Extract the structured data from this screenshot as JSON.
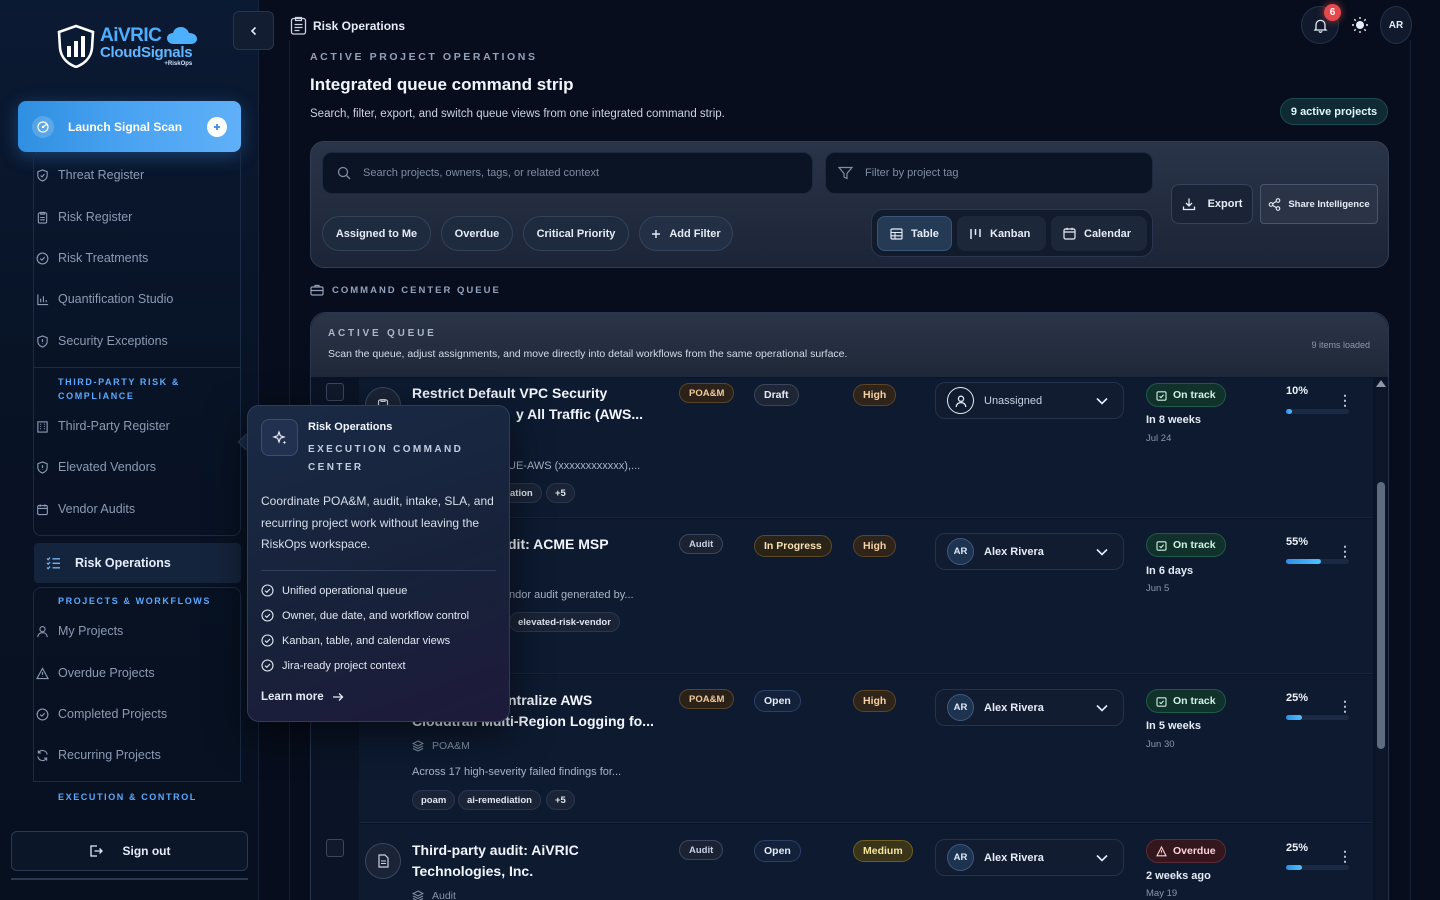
{
  "brand": {
    "name_line1": "AiVRIC",
    "name_line2": "CloudSignals",
    "name_line3": "+RiskOps"
  },
  "sidebar": {
    "launch_label": "Launch Signal Scan",
    "group1": [
      {
        "label": "Threat Register",
        "icon": "shield-icon"
      },
      {
        "label": "Risk Register",
        "icon": "clipboard-icon"
      },
      {
        "label": "Risk Treatments",
        "icon": "check-circle-icon"
      },
      {
        "label": "Quantification Studio",
        "icon": "bar-chart-icon"
      },
      {
        "label": "Security Exceptions",
        "icon": "shield-icon"
      }
    ],
    "section_third_party": "THIRD-PARTY RISK & COMPLIANCE",
    "group2": [
      {
        "label": "Third-Party Register",
        "icon": "building-icon"
      },
      {
        "label": "Elevated Vendors",
        "icon": "shield-icon"
      },
      {
        "label": "Vendor Audits",
        "icon": "calendar-icon"
      }
    ],
    "active_label": "Risk Operations",
    "section_projects": "PROJECTS & WORKFLOWS",
    "group3": [
      {
        "label": "My Projects",
        "icon": "user-icon"
      },
      {
        "label": "Overdue Projects",
        "icon": "warning-icon"
      },
      {
        "label": "Completed Projects",
        "icon": "check-circle-icon"
      },
      {
        "label": "Recurring Projects",
        "icon": "refresh-icon"
      }
    ],
    "section_exec": "EXECUTION & CONTROL",
    "signout_label": "Sign out"
  },
  "topbar": {
    "breadcrumb": "Risk Operations",
    "notification_count": "6",
    "avatar_initials": "AR"
  },
  "header": {
    "eyebrow": "ACTIVE PROJECT OPERATIONS",
    "title": "Integrated queue command strip",
    "subtitle": "Search, filter, export, and switch queue views from one integrated command strip.",
    "active_count": "9 active projects"
  },
  "command_strip": {
    "search_placeholder": "Search projects, owners, tags, or related context",
    "filter_placeholder": "Filter by project tag",
    "chips": [
      "Assigned to Me",
      "Overdue",
      "Critical Priority"
    ],
    "add_filter": "Add Filter",
    "views": [
      "Table",
      "Kanban",
      "Calendar"
    ],
    "selected_view": "Table",
    "export_label": "Export",
    "share_label": "Share Intelligence"
  },
  "queue": {
    "section_label": "COMMAND CENTER QUEUE",
    "title": "ACTIVE QUEUE",
    "subtitle": "Scan the queue, adjust assignments, and move directly into detail workflows from the same operational surface.",
    "items_loaded": "9 items loaded",
    "rows": [
      {
        "title_line1": "Restrict Default VPC Security",
        "title_line2": "y All Traffic (AWS...",
        "desc": "UE-AWS (xxxxxxxxxxxx),...",
        "tag1": "ation",
        "tag_more": "+5",
        "type": "POA&M",
        "state": "Draft",
        "priority": "High",
        "assignee": "Unassigned",
        "assignee_initials": "",
        "status": "On track",
        "due": "In 8 weeks",
        "due_date": "Jul 24",
        "progress_label": "10%",
        "progress": 0.1
      },
      {
        "title_line1": "dit: ACME MSP",
        "title_line2": "",
        "desc": "ndor audit generated by...",
        "tag1": "elevated-risk-vendor",
        "tag_more": "",
        "type": "Audit",
        "state": "In Progress",
        "priority": "High",
        "assignee": "Alex Rivera",
        "assignee_initials": "AR",
        "status": "On track",
        "due": "In 6 days",
        "due_date": "Jun 5",
        "progress_label": "55%",
        "progress": 0.55
      },
      {
        "title_line1": "ntralize AWS",
        "title_line2": "Cloudtrail Multi-Region Logging fo...",
        "meta": "POA&M",
        "desc": "Across 17 high-severity failed findings for...",
        "tag1": "poam",
        "tag2": "ai-remediation",
        "tag_more": "+5",
        "type": "POA&M",
        "state": "Open",
        "priority": "High",
        "assignee": "Alex Rivera",
        "assignee_initials": "AR",
        "status": "On track",
        "due": "In 5 weeks",
        "due_date": "Jun 30",
        "progress_label": "25%",
        "progress": 0.25
      },
      {
        "title_line1": "Third-party audit: AiVRIC",
        "title_line2": "Technologies, Inc.",
        "meta": "Audit",
        "type": "Audit",
        "state": "Open",
        "priority": "Medium",
        "assignee": "Alex Rivera",
        "assignee_initials": "AR",
        "status": "Overdue",
        "due": "2 weeks ago",
        "due_date": "May 19",
        "progress_label": "25%",
        "progress": 0.25
      }
    ]
  },
  "popover": {
    "title": "Risk Operations",
    "eyebrow": "EXECUTION COMMAND CENTER",
    "description": "Coordinate POA&M, audit, intake, SLA, and recurring project work without leaving the RiskOps workspace.",
    "features": [
      "Unified operational queue",
      "Owner, due date, and workflow control",
      "Kanban, table, and calendar views",
      "Jira-ready project context"
    ],
    "learn_more": "Learn more"
  },
  "colors": {
    "accent": "#4aa3f2",
    "background": "#070d1c",
    "success": "#10322b",
    "danger": "#e5484d"
  }
}
